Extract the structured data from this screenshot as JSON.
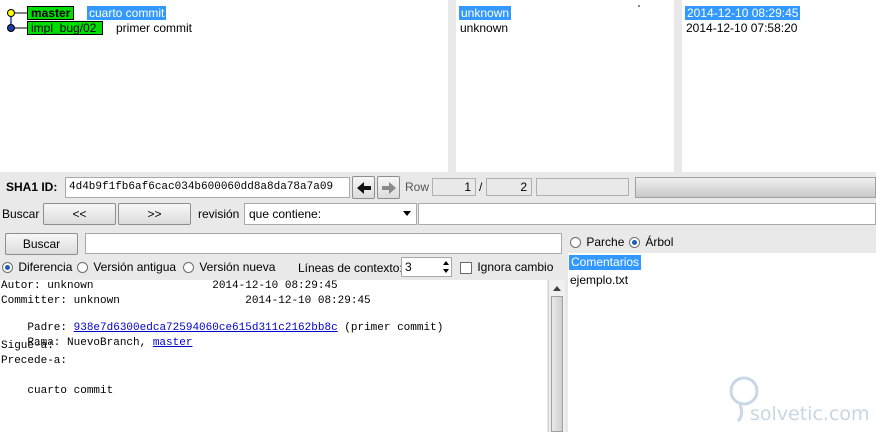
{
  "history": {
    "commits": [
      {
        "refs": [
          "master"
        ],
        "message": "cuarto commit",
        "author": "unknown",
        "date": "2014-12-10 08:29:45",
        "selected": true
      },
      {
        "refs": [
          "impl_bug/02"
        ],
        "message": "primer commit",
        "author": "unknown",
        "date": "2014-12-10 07:58:20",
        "selected": false
      }
    ]
  },
  "sha_bar": {
    "label": "SHA1 ID:",
    "value": "4d4b9f1fb6af6cac034b600060dd8a8da78a7a09",
    "row_label": "Row",
    "row_current": "1",
    "row_separator": "/",
    "row_total": "2"
  },
  "find_bar": {
    "label": "Buscar",
    "prev_label": "<<",
    "next_label": ">>",
    "type_label": "revisión",
    "mode_value": "que contiene:"
  },
  "search_bar": {
    "button_label": "Buscar"
  },
  "diff_options": {
    "options": [
      "Diferencia",
      "Versión antigua",
      "Versión nueva"
    ],
    "selected": "Diferencia",
    "context_label": "Líneas de contexto:",
    "context_value": "3",
    "ignore_label": "Ignora cambio"
  },
  "details": {
    "author_line": "Autor: unknown                  2014-12-10 08:29:45",
    "committer_line": "Committer: unknown                   2014-12-10 08:29:45",
    "parent_label": "Padre: ",
    "parent_sha": "938e7d6300edca72594060ce615d311c2162bb8c",
    "parent_suffix": " (primer commit)",
    "branch_label": "Rama: NuevoBranch, ",
    "branch_link": "master",
    "follows_line": "Sigue-a:",
    "precedes_line": "Precede-a:",
    "message_line": "    cuarto commit"
  },
  "file_panel": {
    "modes": [
      "Parche",
      "Árbol"
    ],
    "selected_mode": "Árbol",
    "items": [
      "Comentarios",
      "ejemplo.txt"
    ]
  },
  "watermark": "solvetic.com"
}
